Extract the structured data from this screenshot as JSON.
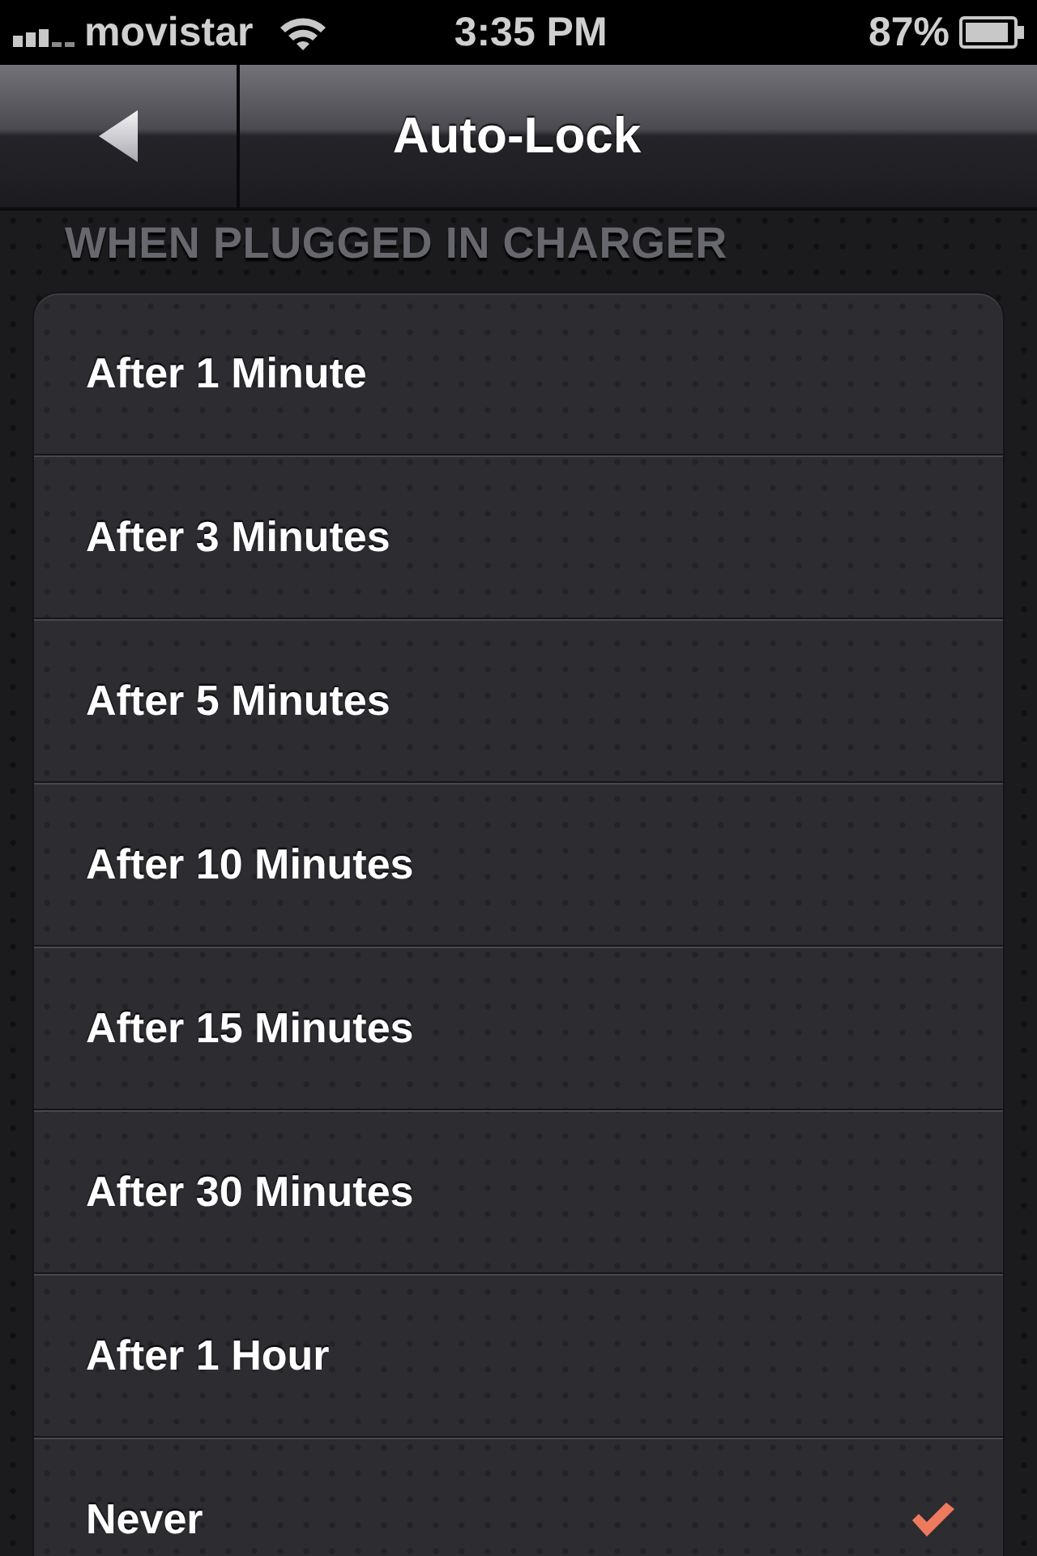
{
  "status_bar": {
    "carrier": "movistar",
    "time": "3:35 PM",
    "battery": "87%"
  },
  "nav_bar": {
    "title": "Auto-Lock"
  },
  "section": {
    "header": "WHEN PLUGGED IN CHARGER",
    "options": [
      {
        "label": "After 1 Minute",
        "selected": false
      },
      {
        "label": "After 3 Minutes",
        "selected": false
      },
      {
        "label": "After 5 Minutes",
        "selected": false
      },
      {
        "label": "After 10 Minutes",
        "selected": false
      },
      {
        "label": "After 15 Minutes",
        "selected": false
      },
      {
        "label": "After 30 Minutes",
        "selected": false
      },
      {
        "label": "After 1 Hour",
        "selected": false
      },
      {
        "label": "Never",
        "selected": true
      }
    ]
  }
}
